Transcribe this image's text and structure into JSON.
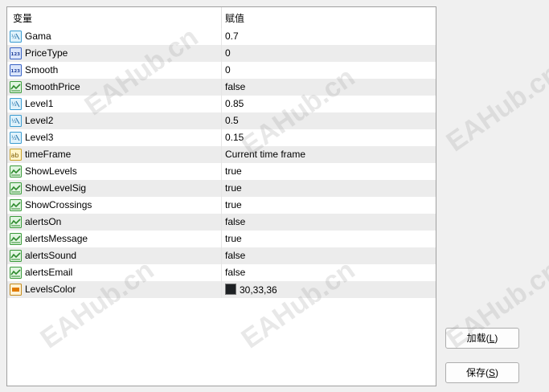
{
  "header": {
    "col_name": "变量",
    "col_value": "赋值"
  },
  "rows": [
    {
      "name": "Gama",
      "value": "0.7",
      "icon": "double-value-icon"
    },
    {
      "name": "PriceType",
      "value": "0",
      "icon": "integer-value-icon"
    },
    {
      "name": "Smooth",
      "value": "0",
      "icon": "integer-value-icon"
    },
    {
      "name": "SmoothPrice",
      "value": "false",
      "icon": "boolean-value-icon"
    },
    {
      "name": "Level1",
      "value": "0.85",
      "icon": "double-value-icon"
    },
    {
      "name": "Level2",
      "value": "0.5",
      "icon": "double-value-icon"
    },
    {
      "name": "Level3",
      "value": "0.15",
      "icon": "double-value-icon"
    },
    {
      "name": "timeFrame",
      "value": "Current time frame",
      "icon": "enum-value-icon"
    },
    {
      "name": "ShowLevels",
      "value": "true",
      "icon": "boolean-value-icon"
    },
    {
      "name": "ShowLevelSig",
      "value": "true",
      "icon": "boolean-value-icon"
    },
    {
      "name": "ShowCrossings",
      "value": "true",
      "icon": "boolean-value-icon"
    },
    {
      "name": "alertsOn",
      "value": "false",
      "icon": "boolean-value-icon"
    },
    {
      "name": "alertsMessage",
      "value": "true",
      "icon": "boolean-value-icon"
    },
    {
      "name": "alertsSound",
      "value": "false",
      "icon": "boolean-value-icon"
    },
    {
      "name": "alertsEmail",
      "value": "false",
      "icon": "boolean-value-icon"
    },
    {
      "name": "LevelsColor",
      "value": "30,33,36",
      "icon": "color-value-icon",
      "swatch": "#1e2124"
    }
  ],
  "buttons": {
    "load_label": "加载(",
    "load_key": "L",
    "load_close": ")",
    "save_label": "保存(",
    "save_key": "S",
    "save_close": ")"
  },
  "watermark": "EAHub.cn"
}
